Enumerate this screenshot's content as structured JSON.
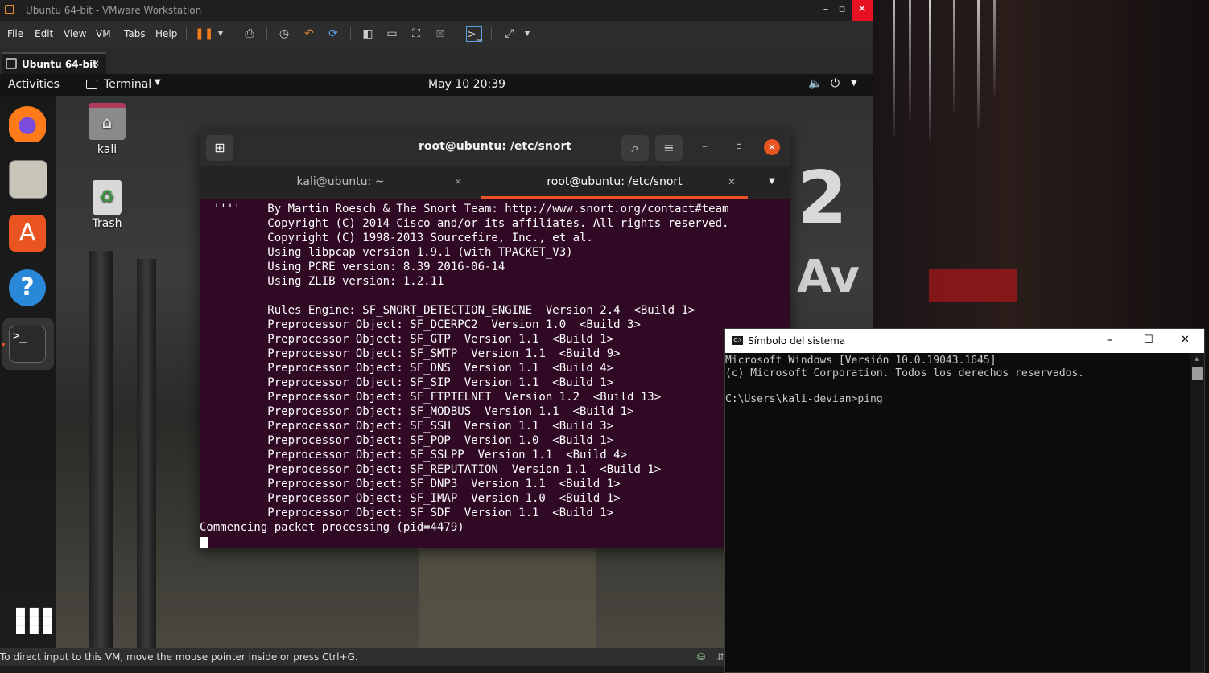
{
  "vmware": {
    "window_title": "Ubuntu 64-bit - VMware Workstation",
    "controls": {
      "minimize": "–",
      "maximize": "▫",
      "close": "✕"
    },
    "menu": [
      "File",
      "Edit",
      "View",
      "VM",
      "Tabs",
      "Help"
    ],
    "vm_tab": {
      "label": "Ubuntu 64-bit",
      "close": "✕"
    },
    "status_text": "To direct input to this VM, move the mouse pointer inside or press Ctrl+G."
  },
  "ubuntu": {
    "topbar": {
      "activities": "Activities",
      "app_menu": "Terminal",
      "clock": "May 10  20:39"
    },
    "desktop_icons": [
      {
        "label": "kali"
      },
      {
        "label": "Trash"
      }
    ]
  },
  "terminal": {
    "title": "root@ubuntu: /etc/snort",
    "tabs": [
      {
        "label": "kali@ubuntu: ~",
        "active": false
      },
      {
        "label": "root@ubuntu: /etc/snort",
        "active": true
      }
    ],
    "lines": [
      "  ''''    By Martin Roesch & The Snort Team: http://www.snort.org/contact#team",
      "          Copyright (C) 2014 Cisco and/or its affiliates. All rights reserved.",
      "          Copyright (C) 1998-2013 Sourcefire, Inc., et al.",
      "          Using libpcap version 1.9.1 (with TPACKET_V3)",
      "          Using PCRE version: 8.39 2016-06-14",
      "          Using ZLIB version: 1.2.11",
      "",
      "          Rules Engine: SF_SNORT_DETECTION_ENGINE  Version 2.4  <Build 1>",
      "          Preprocessor Object: SF_DCERPC2  Version 1.0  <Build 3>",
      "          Preprocessor Object: SF_GTP  Version 1.1  <Build 1>",
      "          Preprocessor Object: SF_SMTP  Version 1.1  <Build 9>",
      "          Preprocessor Object: SF_DNS  Version 1.1  <Build 4>",
      "          Preprocessor Object: SF_SIP  Version 1.1  <Build 1>",
      "          Preprocessor Object: SF_FTPTELNET  Version 1.2  <Build 13>",
      "          Preprocessor Object: SF_MODBUS  Version 1.1  <Build 1>",
      "          Preprocessor Object: SF_SSH  Version 1.1  <Build 3>",
      "          Preprocessor Object: SF_POP  Version 1.0  <Build 1>",
      "          Preprocessor Object: SF_SSLPP  Version 1.1  <Build 4>",
      "          Preprocessor Object: SF_REPUTATION  Version 1.1  <Build 1>",
      "          Preprocessor Object: SF_DNP3  Version 1.1  <Build 1>",
      "          Preprocessor Object: SF_IMAP  Version 1.0  <Build 1>",
      "          Preprocessor Object: SF_SDF  Version 1.1  <Build 1>",
      "Commencing packet processing (pid=4479)"
    ]
  },
  "cmd": {
    "title": "Símbolo del sistema",
    "lines": [
      "Microsoft Windows [Versión 10.0.19043.1645]",
      "(c) Microsoft Corporation. Todos los derechos reservados.",
      "",
      "C:\\Users\\kali-devian>ping"
    ]
  },
  "colors": {
    "terminal_bg": "#300a24",
    "ubuntu_accent": "#e95420",
    "vmware_close": "#e81123"
  }
}
